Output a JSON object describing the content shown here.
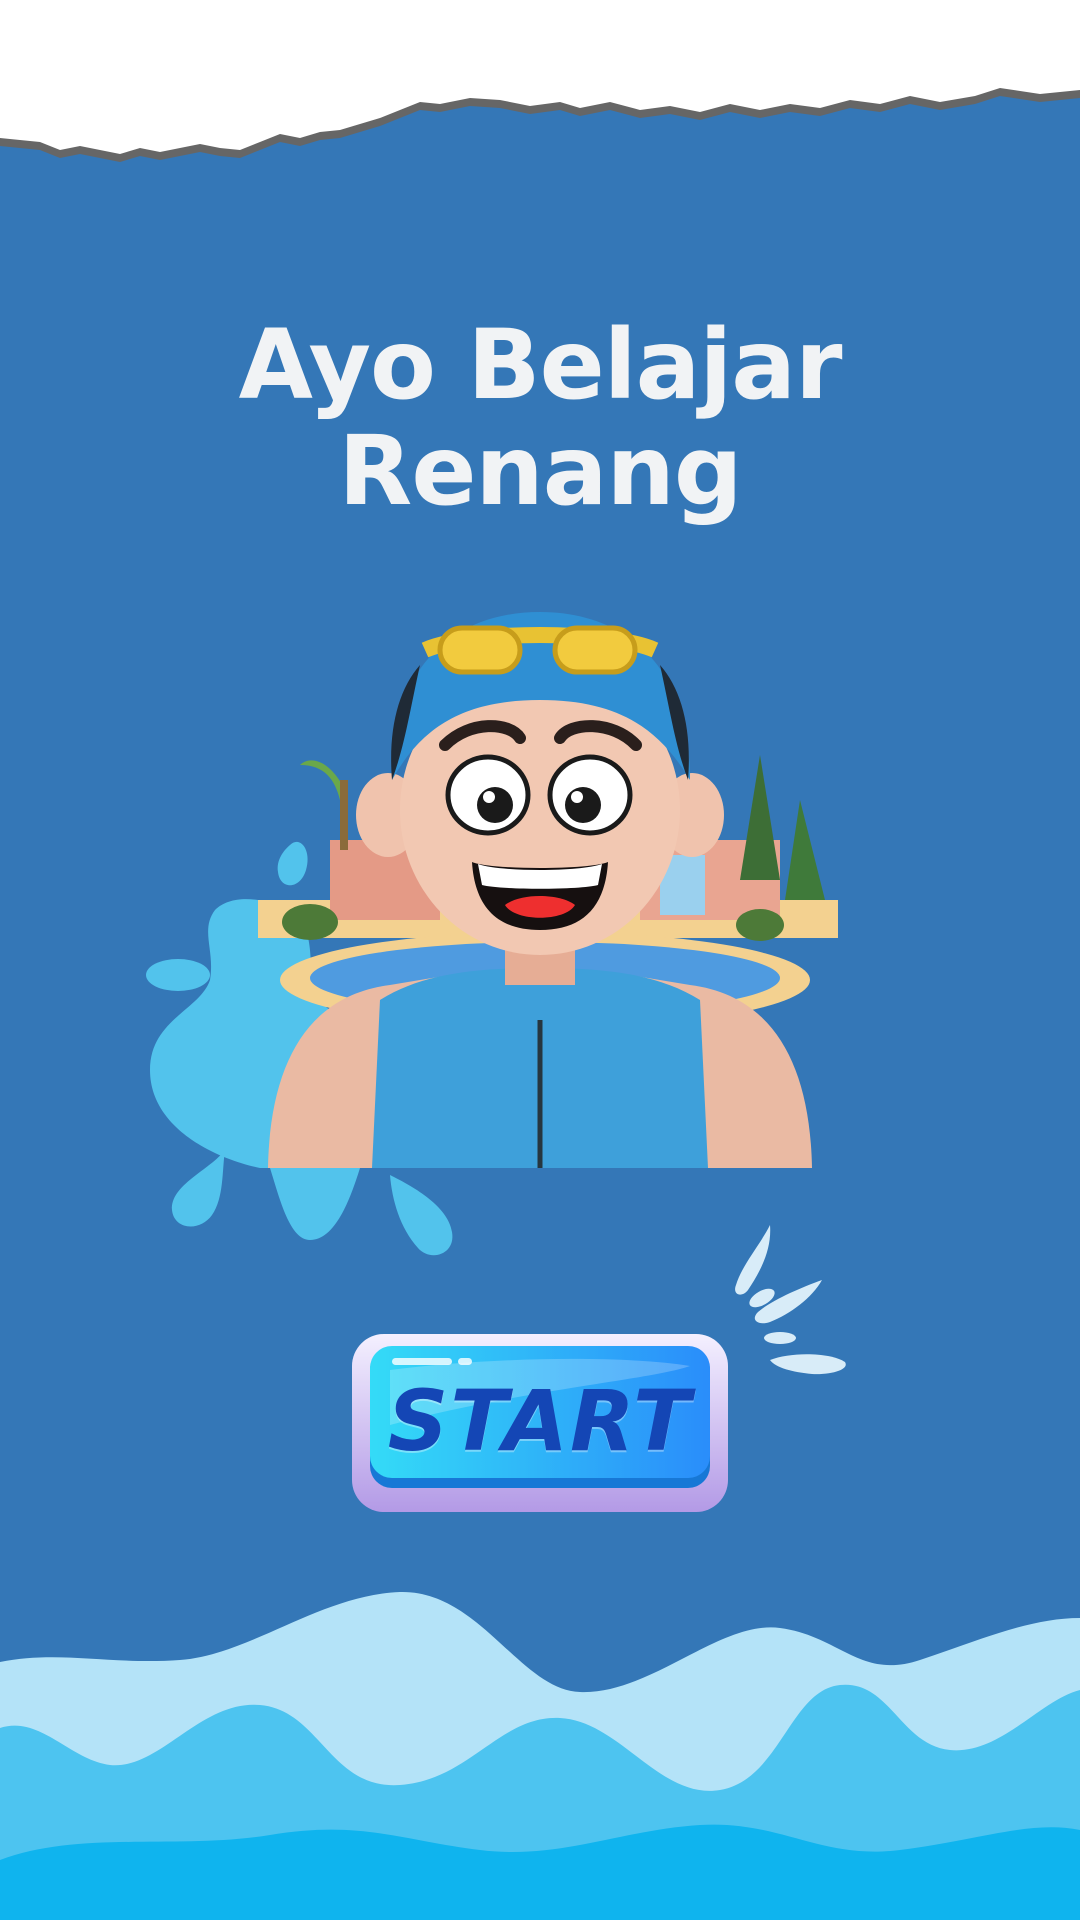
{
  "screen": {
    "title_line1": "Ayo Belajar",
    "title_line2": "Renang",
    "start_label": "START"
  },
  "colors": {
    "background": "#3477b7",
    "title_text": "#f1f3f5",
    "button_face": "#31c9f5",
    "button_text": "#1446b5",
    "wave_light": "#b4e3f8",
    "wave_mid": "#4dc4f0",
    "wave_deep": "#0fb4ee"
  },
  "icons": {
    "character": "swimmer-character-illustration",
    "background_scene": "pool-villa-scene",
    "splash": "water-splash-decoration",
    "droplets": "water-droplet-icons"
  }
}
